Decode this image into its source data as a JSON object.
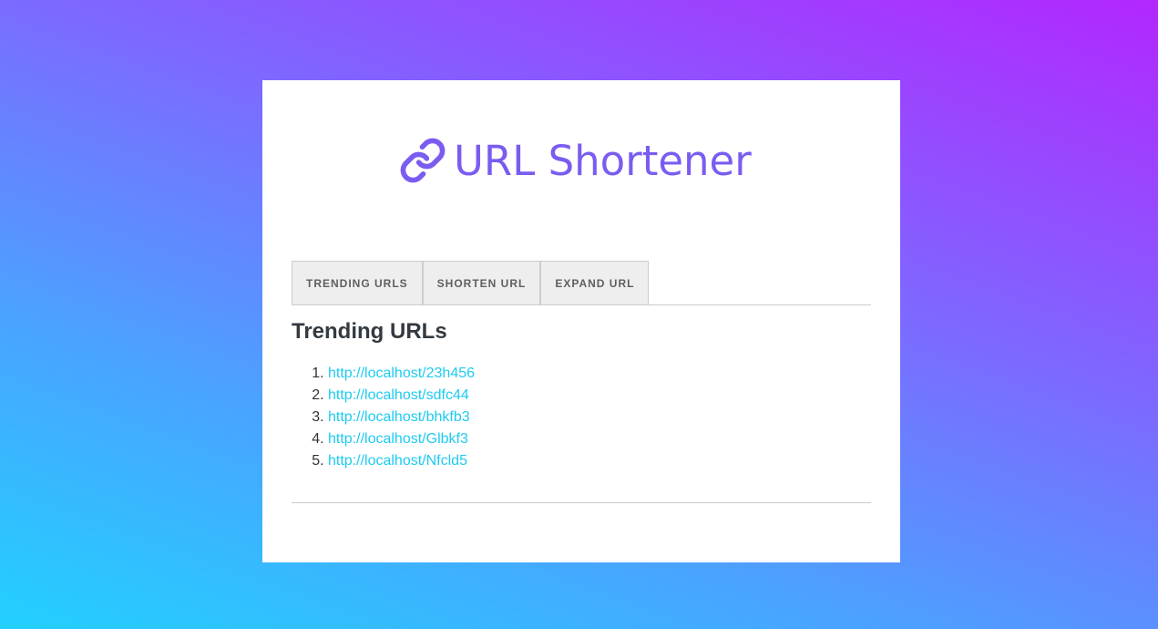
{
  "app": {
    "title": "URL Shortener",
    "logo_icon": "link-icon",
    "colors": {
      "brand": "#7b5cf0",
      "link": "#1ecbf0",
      "tab_bg": "#eeeeee"
    }
  },
  "tabs": [
    {
      "label": "TRENDING URLS"
    },
    {
      "label": "SHORTEN URL"
    },
    {
      "label": "EXPAND URL"
    }
  ],
  "main": {
    "heading": "Trending URLs",
    "urls": [
      {
        "index": "1.",
        "url": "http://localhost/23h456"
      },
      {
        "index": "2.",
        "url": "http://localhost/sdfc44"
      },
      {
        "index": "3.",
        "url": "http://localhost/bhkfb3"
      },
      {
        "index": "4.",
        "url": "http://localhost/Glbkf3"
      },
      {
        "index": "5.",
        "url": "http://localhost/Nfcld5"
      }
    ]
  }
}
